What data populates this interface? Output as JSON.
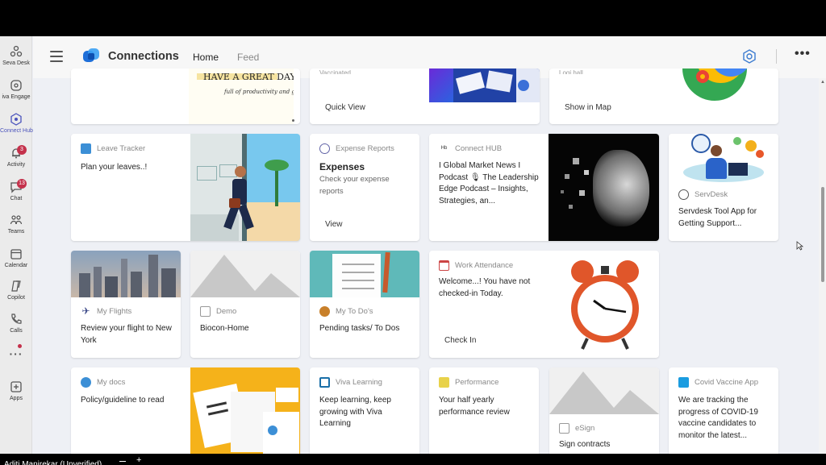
{
  "rail": {
    "items": [
      {
        "label": "Seva Desk",
        "icon": "seva-desk-icon"
      },
      {
        "label": "iva Engage",
        "icon": "engage-icon"
      },
      {
        "label": "Connect Hub",
        "icon": "connect-hub-icon"
      },
      {
        "label": "Activity",
        "icon": "bell-icon",
        "badge": "3"
      },
      {
        "label": "Chat",
        "icon": "chat-icon",
        "badge": "13"
      },
      {
        "label": "Teams",
        "icon": "teams-icon"
      },
      {
        "label": "Calendar",
        "icon": "calendar-icon"
      },
      {
        "label": "Copilot",
        "icon": "copilot-icon"
      },
      {
        "label": "Calls",
        "icon": "phone-icon"
      },
      {
        "label": "",
        "icon": "more-apps-icon"
      },
      {
        "label": "Apps",
        "icon": "add-app-icon"
      }
    ]
  },
  "header": {
    "title": "Connections",
    "tabs": [
      "Home",
      "Feed"
    ],
    "more": "•••"
  },
  "cards": {
    "top": {
      "banner_line1": "HAVE A GREAT DAY",
      "banner_line2": "full of productivity and good vibes",
      "partial_text1": "Vaccinated",
      "quick_view": "Quick View",
      "partial_text2": "Logi hall",
      "show_in_map": "Show in Map"
    },
    "leave": {
      "category": "Leave Tracker",
      "title": "Plan your leaves..!"
    },
    "expense": {
      "category": "Expense Reports",
      "heading": "Expenses",
      "sub": "Check your expense reports",
      "action": "View"
    },
    "connecthub": {
      "category": "Connect HUB",
      "title": "I Global Market News I Podcast 🎙 The Leadership Edge Podcast – Insights, Strategies, an..."
    },
    "servdesk": {
      "category": "ServDesk",
      "title": "Servdesk Tool App for Getting Support..."
    },
    "flights": {
      "category": "My Flights",
      "title": "Review your flight to New York"
    },
    "demo": {
      "category": "Demo",
      "title": "Biocon-Home"
    },
    "todo": {
      "category": "My To Do's",
      "title": "Pending tasks/ To Dos"
    },
    "attendance": {
      "category": "Work Attendance",
      "title": "Welcome...! You have not checked-in Today.",
      "action": "Check In"
    },
    "docs": {
      "category": "My docs",
      "title": "Policy/guideline to read"
    },
    "learning": {
      "category": "Viva Learning",
      "title": "Keep learning, keep growing with Viva Learning"
    },
    "performance": {
      "category": "Performance",
      "title": "Your half yearly performance review"
    },
    "esign": {
      "category": "eSign",
      "title": "Sign contracts"
    },
    "covid": {
      "category": "Covid Vaccine App",
      "title": "We are tracking the progress of COVID-19 vaccine candidates to monitor the latest..."
    }
  },
  "footer": {
    "text": "Aditi Manjrekar (Unverified)"
  },
  "colors": {
    "accent": "#4b53bc",
    "badge": "#c4314b",
    "background": "#eef0f5"
  }
}
